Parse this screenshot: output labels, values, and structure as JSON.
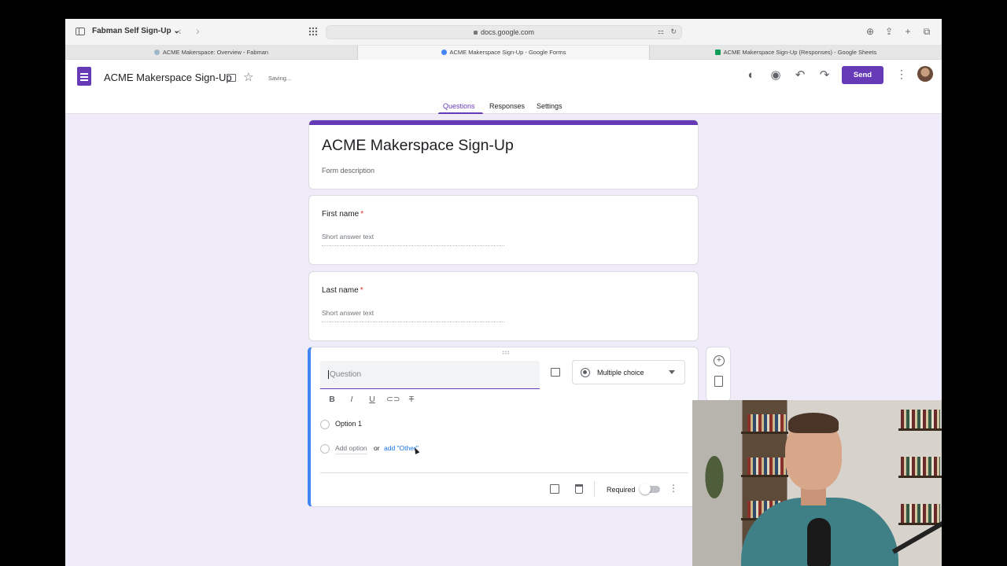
{
  "browser": {
    "profile": "Fabman Self Sign-Up ⌄",
    "url": "docs.google.com",
    "tabs": [
      {
        "label": "ACME Makerspace: Overview - Fabman"
      },
      {
        "label": "ACME Makerspace Sign-Up - Google Forms"
      },
      {
        "label": "ACME Makerspace Sign-Up (Responses) - Google Sheets"
      }
    ]
  },
  "header": {
    "doc_title": "ACME Makerspace Sign-Up",
    "status": "Saving...",
    "send_label": "Send",
    "tabs": [
      "Questions",
      "Responses",
      "Settings"
    ]
  },
  "form": {
    "title": "ACME Makerspace Sign-Up",
    "description": "Form description",
    "questions": [
      {
        "title": "First name",
        "required_mark": "*",
        "placeholder": "Short answer text"
      },
      {
        "title": "Last name",
        "required_mark": "*",
        "placeholder": "Short answer text"
      }
    ],
    "active_question": {
      "placeholder": "Question",
      "type": "Multiple choice",
      "option1": "Option 1",
      "add_option": "Add option",
      "or": "or",
      "add_other": "add \"Other\"",
      "required_label": "Required",
      "required_on": false
    }
  },
  "colors": {
    "accent": "#673ab7",
    "background": "#f0ebf8",
    "active_border": "#4285f4",
    "link": "#1a73e8"
  },
  "icons": [
    "sidebar-icon",
    "back-icon",
    "forward-icon",
    "tab-grid-icon",
    "lock-icon",
    "download-icon",
    "share-icon",
    "new-tab-icon",
    "tab-overview-icon",
    "forms-logo-icon",
    "folder-icon",
    "star-icon",
    "palette-icon",
    "preview-icon",
    "undo-icon",
    "redo-icon",
    "more-vert-icon",
    "image-icon",
    "bold-icon",
    "italic-icon",
    "underline-icon",
    "link-icon",
    "clear-format-icon",
    "copy-icon",
    "trash-icon",
    "add-question-icon",
    "import-icon"
  ]
}
